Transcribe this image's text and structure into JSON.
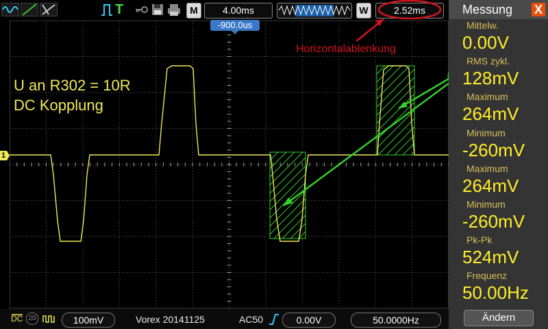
{
  "toolbar": {
    "time_div": "4.00ms",
    "m_label": "M",
    "w_label": "W",
    "delay": "2.52ms",
    "trigger_pos": "-900.0us",
    "wave_label": "WWWWW"
  },
  "annotations": {
    "horizontal": "Horizontalablenkung",
    "line1": "U an  R302 = 10R",
    "line2": "DC Kopplung",
    "ch_marker": "1"
  },
  "side": {
    "title": "Messung",
    "close": "X",
    "measurements": [
      {
        "label": "Mittelw.",
        "value": "0.00V"
      },
      {
        "label": "RMS  zykl.",
        "value": "128mV"
      },
      {
        "label": "Maximum",
        "value": "264mV"
      },
      {
        "label": "Minimum",
        "value": "-260mV"
      },
      {
        "label": "Maximum",
        "value": "264mV"
      },
      {
        "label": "Minimum",
        "value": "-260mV"
      },
      {
        "label": "Pk-Pk",
        "value": "524mV"
      },
      {
        "label": "Frequenz",
        "value": "50.00Hz"
      }
    ],
    "aendern": "Ändern"
  },
  "status": {
    "dc": "DC",
    "twenty": "20",
    "volts_div": "100mV",
    "device": "Vorex 20141125",
    "ac": "AC50",
    "trig_level": "0.00V",
    "freq": "50.0000Hz"
  },
  "colors": {
    "trace": "#f0ea5a",
    "menu_accent": "#e94e0b",
    "annotation_red": "#d4141e",
    "annotation_green": "#34d12c"
  }
}
